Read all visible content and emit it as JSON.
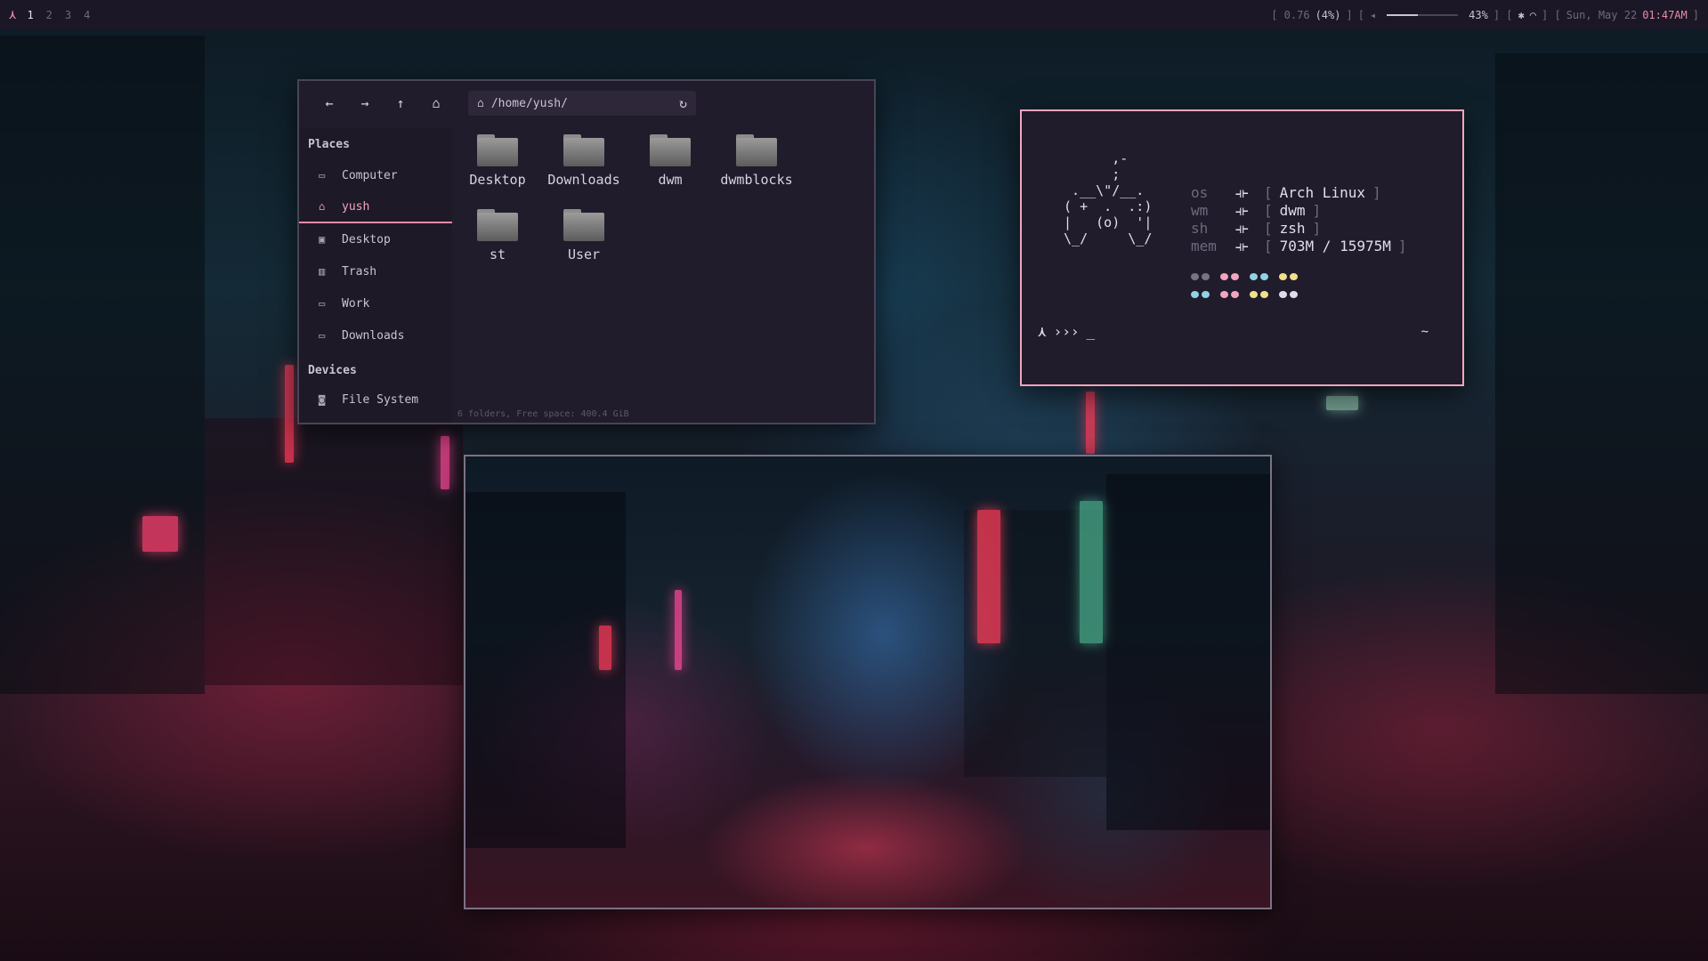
{
  "bar": {
    "logo": "⋏",
    "tags": [
      "1",
      "2",
      "3",
      "4"
    ],
    "active_tag": "1",
    "load_open": "[ 0.76",
    "load_pct": "(4%)",
    "load_close": "]",
    "bracket_open": "[",
    "speaker_icon": "◂",
    "volume_fraction": 0.43,
    "volume_text": "43%",
    "bracket_mid": "] [",
    "bluetooth_icon": "✱",
    "wifi_icon": "◠",
    "bracket_mid2": "] [",
    "date": "Sun, May 22",
    "time": "01:47AM",
    "bracket_close": "]"
  },
  "file_manager": {
    "path": "/home/yush/",
    "places_heading": "Places",
    "devices_heading": "Devices",
    "places": [
      {
        "label": "Computer",
        "icon": "computer-icon",
        "active": false
      },
      {
        "label": "yush",
        "icon": "home-icon",
        "active": true
      },
      {
        "label": "Desktop",
        "icon": "desktop-icon",
        "active": false
      },
      {
        "label": "Trash",
        "icon": "trash-icon",
        "active": false
      },
      {
        "label": "Work",
        "icon": "folder-icon",
        "active": false
      },
      {
        "label": "Downloads",
        "icon": "folder-icon",
        "active": false
      }
    ],
    "devices": [
      {
        "label": "File System",
        "icon": "drive-icon"
      }
    ],
    "files": [
      "Desktop",
      "Downloads",
      "dwm",
      "dwmblocks",
      "st",
      "User"
    ],
    "status": "6 folders, Free space: 400.4 GiB"
  },
  "terminal": {
    "ascii_art": "       ,-\n       ;\n  .__\\\"/__.\n ( +  .  .:)\n |   (o)  '|\n \\_/     \\_/",
    "info": [
      {
        "key": "os",
        "value": "Arch Linux"
      },
      {
        "key": "wm",
        "value": "dwm"
      },
      {
        "key": "sh",
        "value": "zsh"
      },
      {
        "key": "mem",
        "value": "703M / 15975M"
      }
    ],
    "arrow": "⟛",
    "bracket_open": "[",
    "bracket_close": "]",
    "palette_rows": [
      [
        "#7a7386",
        "#f2a5bd",
        "#8fd3e6",
        "#f1e08a"
      ],
      [
        "#8fd3e6",
        "#f2a5bd",
        "#f1e08a",
        "#e2dcea"
      ]
    ],
    "prompt_symbol": "⋏",
    "prompt_arrows": "›››",
    "cursor": "_",
    "cwd": "~"
  },
  "colors": {
    "accent_pink": "#e98ba6",
    "bar_bg": "#1b1726",
    "window_bg": "#211c2c"
  }
}
